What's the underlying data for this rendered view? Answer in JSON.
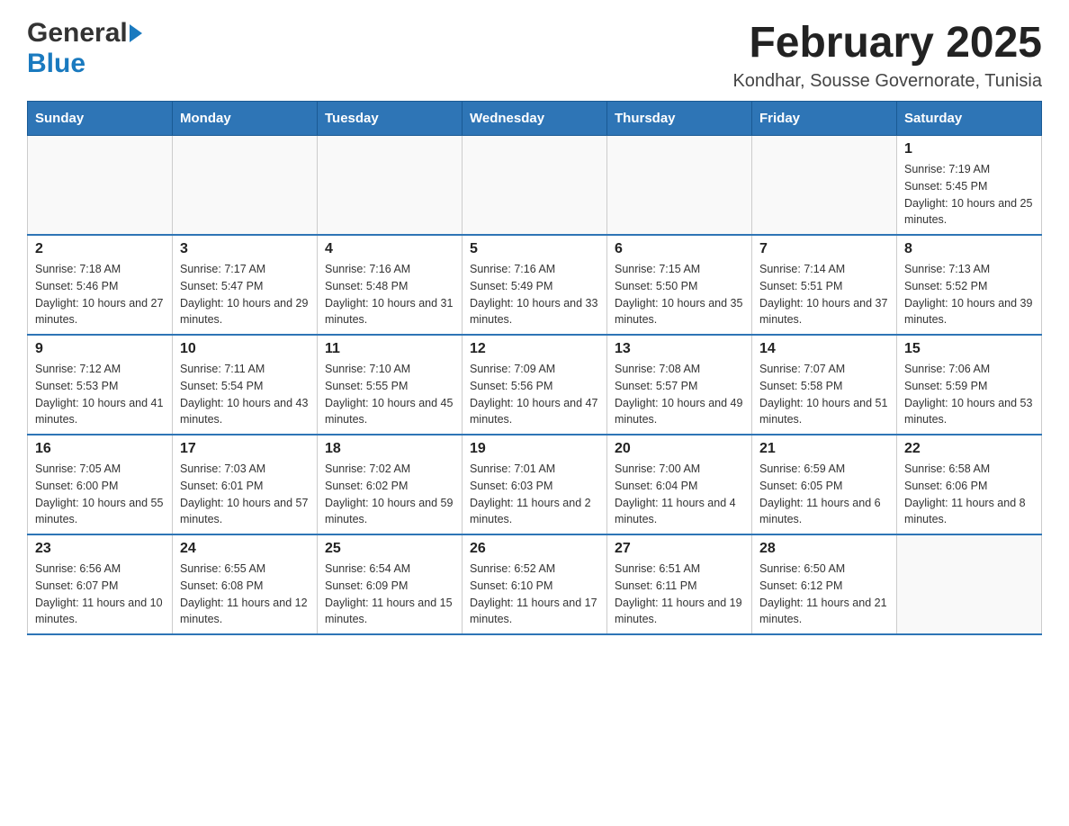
{
  "header": {
    "logo": {
      "general": "General",
      "blue": "Blue"
    },
    "title": "February 2025",
    "subtitle": "Kondhar, Sousse Governorate, Tunisia"
  },
  "calendar": {
    "weekdays": [
      "Sunday",
      "Monday",
      "Tuesday",
      "Wednesday",
      "Thursday",
      "Friday",
      "Saturday"
    ],
    "weeks": [
      [
        {
          "day": "",
          "info": ""
        },
        {
          "day": "",
          "info": ""
        },
        {
          "day": "",
          "info": ""
        },
        {
          "day": "",
          "info": ""
        },
        {
          "day": "",
          "info": ""
        },
        {
          "day": "",
          "info": ""
        },
        {
          "day": "1",
          "info": "Sunrise: 7:19 AM\nSunset: 5:45 PM\nDaylight: 10 hours and 25 minutes."
        }
      ],
      [
        {
          "day": "2",
          "info": "Sunrise: 7:18 AM\nSunset: 5:46 PM\nDaylight: 10 hours and 27 minutes."
        },
        {
          "day": "3",
          "info": "Sunrise: 7:17 AM\nSunset: 5:47 PM\nDaylight: 10 hours and 29 minutes."
        },
        {
          "day": "4",
          "info": "Sunrise: 7:16 AM\nSunset: 5:48 PM\nDaylight: 10 hours and 31 minutes."
        },
        {
          "day": "5",
          "info": "Sunrise: 7:16 AM\nSunset: 5:49 PM\nDaylight: 10 hours and 33 minutes."
        },
        {
          "day": "6",
          "info": "Sunrise: 7:15 AM\nSunset: 5:50 PM\nDaylight: 10 hours and 35 minutes."
        },
        {
          "day": "7",
          "info": "Sunrise: 7:14 AM\nSunset: 5:51 PM\nDaylight: 10 hours and 37 minutes."
        },
        {
          "day": "8",
          "info": "Sunrise: 7:13 AM\nSunset: 5:52 PM\nDaylight: 10 hours and 39 minutes."
        }
      ],
      [
        {
          "day": "9",
          "info": "Sunrise: 7:12 AM\nSunset: 5:53 PM\nDaylight: 10 hours and 41 minutes."
        },
        {
          "day": "10",
          "info": "Sunrise: 7:11 AM\nSunset: 5:54 PM\nDaylight: 10 hours and 43 minutes."
        },
        {
          "day": "11",
          "info": "Sunrise: 7:10 AM\nSunset: 5:55 PM\nDaylight: 10 hours and 45 minutes."
        },
        {
          "day": "12",
          "info": "Sunrise: 7:09 AM\nSunset: 5:56 PM\nDaylight: 10 hours and 47 minutes."
        },
        {
          "day": "13",
          "info": "Sunrise: 7:08 AM\nSunset: 5:57 PM\nDaylight: 10 hours and 49 minutes."
        },
        {
          "day": "14",
          "info": "Sunrise: 7:07 AM\nSunset: 5:58 PM\nDaylight: 10 hours and 51 minutes."
        },
        {
          "day": "15",
          "info": "Sunrise: 7:06 AM\nSunset: 5:59 PM\nDaylight: 10 hours and 53 minutes."
        }
      ],
      [
        {
          "day": "16",
          "info": "Sunrise: 7:05 AM\nSunset: 6:00 PM\nDaylight: 10 hours and 55 minutes."
        },
        {
          "day": "17",
          "info": "Sunrise: 7:03 AM\nSunset: 6:01 PM\nDaylight: 10 hours and 57 minutes."
        },
        {
          "day": "18",
          "info": "Sunrise: 7:02 AM\nSunset: 6:02 PM\nDaylight: 10 hours and 59 minutes."
        },
        {
          "day": "19",
          "info": "Sunrise: 7:01 AM\nSunset: 6:03 PM\nDaylight: 11 hours and 2 minutes."
        },
        {
          "day": "20",
          "info": "Sunrise: 7:00 AM\nSunset: 6:04 PM\nDaylight: 11 hours and 4 minutes."
        },
        {
          "day": "21",
          "info": "Sunrise: 6:59 AM\nSunset: 6:05 PM\nDaylight: 11 hours and 6 minutes."
        },
        {
          "day": "22",
          "info": "Sunrise: 6:58 AM\nSunset: 6:06 PM\nDaylight: 11 hours and 8 minutes."
        }
      ],
      [
        {
          "day": "23",
          "info": "Sunrise: 6:56 AM\nSunset: 6:07 PM\nDaylight: 11 hours and 10 minutes."
        },
        {
          "day": "24",
          "info": "Sunrise: 6:55 AM\nSunset: 6:08 PM\nDaylight: 11 hours and 12 minutes."
        },
        {
          "day": "25",
          "info": "Sunrise: 6:54 AM\nSunset: 6:09 PM\nDaylight: 11 hours and 15 minutes."
        },
        {
          "day": "26",
          "info": "Sunrise: 6:52 AM\nSunset: 6:10 PM\nDaylight: 11 hours and 17 minutes."
        },
        {
          "day": "27",
          "info": "Sunrise: 6:51 AM\nSunset: 6:11 PM\nDaylight: 11 hours and 19 minutes."
        },
        {
          "day": "28",
          "info": "Sunrise: 6:50 AM\nSunset: 6:12 PM\nDaylight: 11 hours and 21 minutes."
        },
        {
          "day": "",
          "info": ""
        }
      ]
    ]
  }
}
